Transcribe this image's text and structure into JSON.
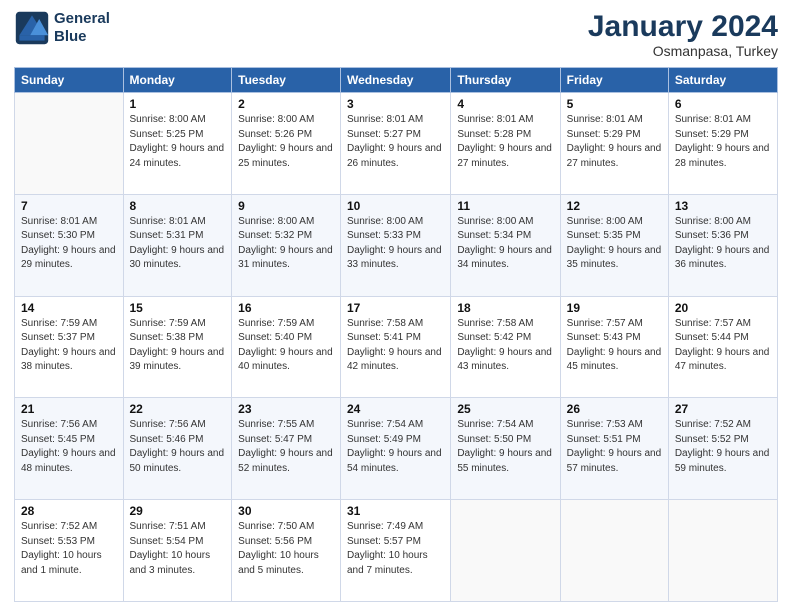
{
  "logo": {
    "line1": "General",
    "line2": "Blue"
  },
  "title": "January 2024",
  "subtitle": "Osmanpasa, Turkey",
  "header_days": [
    "Sunday",
    "Monday",
    "Tuesday",
    "Wednesday",
    "Thursday",
    "Friday",
    "Saturday"
  ],
  "weeks": [
    [
      {
        "day": "",
        "sunrise": "",
        "sunset": "",
        "daylight": ""
      },
      {
        "day": "1",
        "sunrise": "Sunrise: 8:00 AM",
        "sunset": "Sunset: 5:25 PM",
        "daylight": "Daylight: 9 hours and 24 minutes."
      },
      {
        "day": "2",
        "sunrise": "Sunrise: 8:00 AM",
        "sunset": "Sunset: 5:26 PM",
        "daylight": "Daylight: 9 hours and 25 minutes."
      },
      {
        "day": "3",
        "sunrise": "Sunrise: 8:01 AM",
        "sunset": "Sunset: 5:27 PM",
        "daylight": "Daylight: 9 hours and 26 minutes."
      },
      {
        "day": "4",
        "sunrise": "Sunrise: 8:01 AM",
        "sunset": "Sunset: 5:28 PM",
        "daylight": "Daylight: 9 hours and 27 minutes."
      },
      {
        "day": "5",
        "sunrise": "Sunrise: 8:01 AM",
        "sunset": "Sunset: 5:29 PM",
        "daylight": "Daylight: 9 hours and 27 minutes."
      },
      {
        "day": "6",
        "sunrise": "Sunrise: 8:01 AM",
        "sunset": "Sunset: 5:29 PM",
        "daylight": "Daylight: 9 hours and 28 minutes."
      }
    ],
    [
      {
        "day": "7",
        "sunrise": "Sunrise: 8:01 AM",
        "sunset": "Sunset: 5:30 PM",
        "daylight": "Daylight: 9 hours and 29 minutes."
      },
      {
        "day": "8",
        "sunrise": "Sunrise: 8:01 AM",
        "sunset": "Sunset: 5:31 PM",
        "daylight": "Daylight: 9 hours and 30 minutes."
      },
      {
        "day": "9",
        "sunrise": "Sunrise: 8:00 AM",
        "sunset": "Sunset: 5:32 PM",
        "daylight": "Daylight: 9 hours and 31 minutes."
      },
      {
        "day": "10",
        "sunrise": "Sunrise: 8:00 AM",
        "sunset": "Sunset: 5:33 PM",
        "daylight": "Daylight: 9 hours and 33 minutes."
      },
      {
        "day": "11",
        "sunrise": "Sunrise: 8:00 AM",
        "sunset": "Sunset: 5:34 PM",
        "daylight": "Daylight: 9 hours and 34 minutes."
      },
      {
        "day": "12",
        "sunrise": "Sunrise: 8:00 AM",
        "sunset": "Sunset: 5:35 PM",
        "daylight": "Daylight: 9 hours and 35 minutes."
      },
      {
        "day": "13",
        "sunrise": "Sunrise: 8:00 AM",
        "sunset": "Sunset: 5:36 PM",
        "daylight": "Daylight: 9 hours and 36 minutes."
      }
    ],
    [
      {
        "day": "14",
        "sunrise": "Sunrise: 7:59 AM",
        "sunset": "Sunset: 5:37 PM",
        "daylight": "Daylight: 9 hours and 38 minutes."
      },
      {
        "day": "15",
        "sunrise": "Sunrise: 7:59 AM",
        "sunset": "Sunset: 5:38 PM",
        "daylight": "Daylight: 9 hours and 39 minutes."
      },
      {
        "day": "16",
        "sunrise": "Sunrise: 7:59 AM",
        "sunset": "Sunset: 5:40 PM",
        "daylight": "Daylight: 9 hours and 40 minutes."
      },
      {
        "day": "17",
        "sunrise": "Sunrise: 7:58 AM",
        "sunset": "Sunset: 5:41 PM",
        "daylight": "Daylight: 9 hours and 42 minutes."
      },
      {
        "day": "18",
        "sunrise": "Sunrise: 7:58 AM",
        "sunset": "Sunset: 5:42 PM",
        "daylight": "Daylight: 9 hours and 43 minutes."
      },
      {
        "day": "19",
        "sunrise": "Sunrise: 7:57 AM",
        "sunset": "Sunset: 5:43 PM",
        "daylight": "Daylight: 9 hours and 45 minutes."
      },
      {
        "day": "20",
        "sunrise": "Sunrise: 7:57 AM",
        "sunset": "Sunset: 5:44 PM",
        "daylight": "Daylight: 9 hours and 47 minutes."
      }
    ],
    [
      {
        "day": "21",
        "sunrise": "Sunrise: 7:56 AM",
        "sunset": "Sunset: 5:45 PM",
        "daylight": "Daylight: 9 hours and 48 minutes."
      },
      {
        "day": "22",
        "sunrise": "Sunrise: 7:56 AM",
        "sunset": "Sunset: 5:46 PM",
        "daylight": "Daylight: 9 hours and 50 minutes."
      },
      {
        "day": "23",
        "sunrise": "Sunrise: 7:55 AM",
        "sunset": "Sunset: 5:47 PM",
        "daylight": "Daylight: 9 hours and 52 minutes."
      },
      {
        "day": "24",
        "sunrise": "Sunrise: 7:54 AM",
        "sunset": "Sunset: 5:49 PM",
        "daylight": "Daylight: 9 hours and 54 minutes."
      },
      {
        "day": "25",
        "sunrise": "Sunrise: 7:54 AM",
        "sunset": "Sunset: 5:50 PM",
        "daylight": "Daylight: 9 hours and 55 minutes."
      },
      {
        "day": "26",
        "sunrise": "Sunrise: 7:53 AM",
        "sunset": "Sunset: 5:51 PM",
        "daylight": "Daylight: 9 hours and 57 minutes."
      },
      {
        "day": "27",
        "sunrise": "Sunrise: 7:52 AM",
        "sunset": "Sunset: 5:52 PM",
        "daylight": "Daylight: 9 hours and 59 minutes."
      }
    ],
    [
      {
        "day": "28",
        "sunrise": "Sunrise: 7:52 AM",
        "sunset": "Sunset: 5:53 PM",
        "daylight": "Daylight: 10 hours and 1 minute."
      },
      {
        "day": "29",
        "sunrise": "Sunrise: 7:51 AM",
        "sunset": "Sunset: 5:54 PM",
        "daylight": "Daylight: 10 hours and 3 minutes."
      },
      {
        "day": "30",
        "sunrise": "Sunrise: 7:50 AM",
        "sunset": "Sunset: 5:56 PM",
        "daylight": "Daylight: 10 hours and 5 minutes."
      },
      {
        "day": "31",
        "sunrise": "Sunrise: 7:49 AM",
        "sunset": "Sunset: 5:57 PM",
        "daylight": "Daylight: 10 hours and 7 minutes."
      },
      {
        "day": "",
        "sunrise": "",
        "sunset": "",
        "daylight": ""
      },
      {
        "day": "",
        "sunrise": "",
        "sunset": "",
        "daylight": ""
      },
      {
        "day": "",
        "sunrise": "",
        "sunset": "",
        "daylight": ""
      }
    ]
  ]
}
